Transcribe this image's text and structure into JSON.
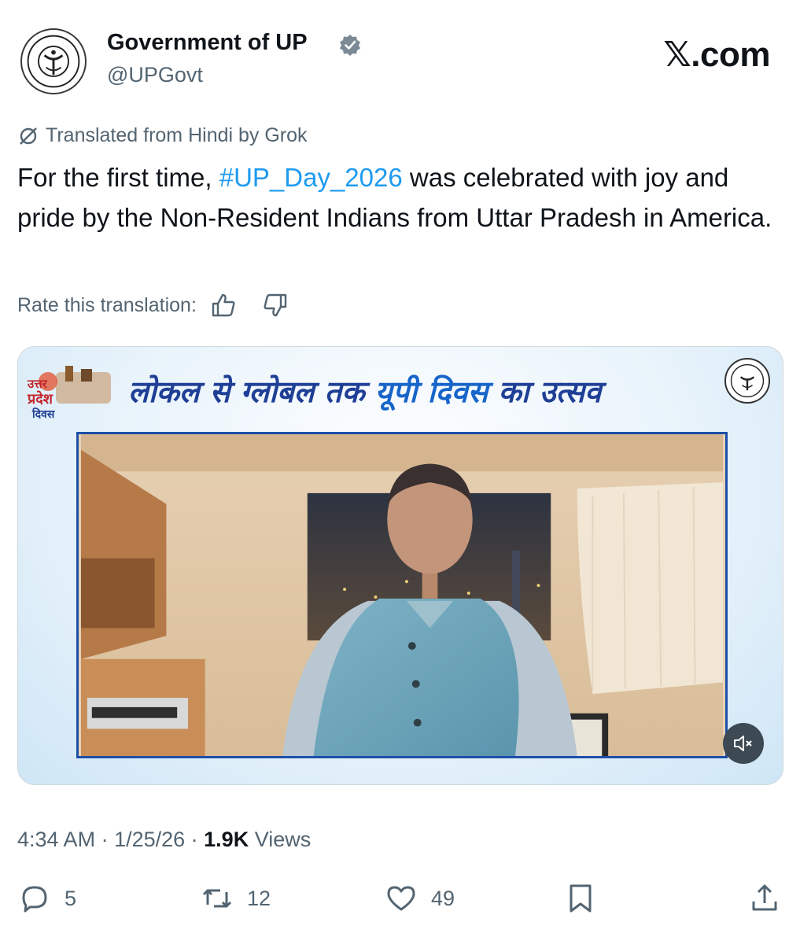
{
  "author": {
    "display_name": "Government of UP",
    "handle": "@UPGovt",
    "verified_icon": "verified-badge-icon"
  },
  "site_logo": "𝕏.com",
  "translation": {
    "notice": "Translated from Hindi by Grok",
    "rate_label": "Rate this translation:"
  },
  "tweet": {
    "text_before": "For the first time, ",
    "hashtag": "#UP_Day_2026",
    "text_after": " was celebrated with joy and pride by the Non-Resident Indians from Uttar Pradesh in America."
  },
  "media": {
    "banner_part1": "लोकल से ग्लोबल तक ",
    "banner_part2": "यूपी दिवस",
    "banner_part3": " का उत्सव",
    "festival_logo_text": "उत्तर प्रदेश दिवस",
    "mute_icon": "speaker-muted-icon"
  },
  "meta": {
    "time": "4:34 AM",
    "sep1": " · ",
    "date": "1/25/26",
    "sep2": " · ",
    "views_count": "1.9K",
    "views_label": " Views"
  },
  "actions": {
    "replies": "5",
    "reposts": "12",
    "likes": "49"
  },
  "colors": {
    "link": "#1d9bf0",
    "secondary_text": "#536471",
    "primary_text": "#0f1419",
    "banner_text": "#1f3f96"
  }
}
